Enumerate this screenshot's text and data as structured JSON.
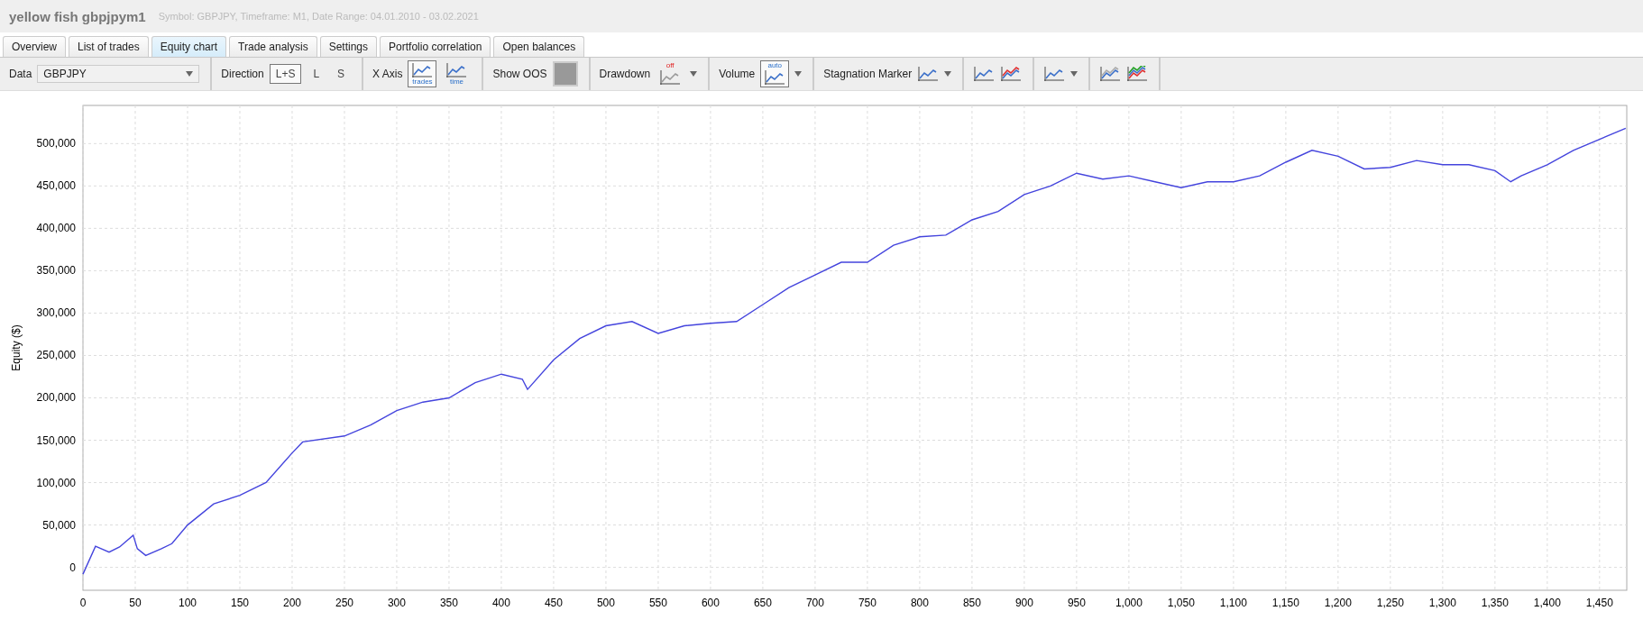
{
  "title": "yellow fish gbpjpym1",
  "subtitle": "Symbol: GBPJPY, Timeframe: M1, Date Range: 04.01.2010 - 03.02.2021",
  "tabs": [
    {
      "label": "Overview",
      "selected": false
    },
    {
      "label": "List of trades",
      "selected": false
    },
    {
      "label": "Equity chart",
      "selected": true
    },
    {
      "label": "Trade analysis",
      "selected": false
    },
    {
      "label": "Settings",
      "selected": false
    },
    {
      "label": "Portfolio correlation",
      "selected": false
    },
    {
      "label": "Open balances",
      "selected": false
    }
  ],
  "toolbar": {
    "data": {
      "label": "Data",
      "value": "GBPJPY"
    },
    "direction": {
      "label": "Direction",
      "options": [
        {
          "label": "L+S",
          "selected": true
        },
        {
          "label": "L",
          "selected": false
        },
        {
          "label": "S",
          "selected": false
        }
      ]
    },
    "x_axis": {
      "label": "X Axis",
      "options": [
        {
          "label": "trades",
          "selected": true
        },
        {
          "label": "time",
          "selected": false
        }
      ]
    },
    "show_oos": {
      "label": "Show OOS",
      "on": false
    },
    "drawdown": {
      "label": "Drawdown",
      "icon_text": "off"
    },
    "volume": {
      "label": "Volume",
      "icon_text": "auto"
    },
    "stagnation": {
      "label": "Stagnation Marker"
    }
  },
  "chart_data": {
    "type": "line",
    "ylabel": "Equity ($)",
    "x": [
      0,
      12,
      25,
      35,
      48,
      52,
      60,
      75,
      85,
      100,
      125,
      150,
      175,
      200,
      210,
      250,
      275,
      300,
      325,
      350,
      375,
      400,
      420,
      425,
      450,
      475,
      500,
      525,
      550,
      575,
      600,
      625,
      650,
      675,
      700,
      725,
      750,
      775,
      800,
      825,
      850,
      875,
      900,
      925,
      950,
      975,
      1000,
      1025,
      1050,
      1075,
      1100,
      1125,
      1150,
      1175,
      1200,
      1225,
      1250,
      1275,
      1300,
      1325,
      1350,
      1365,
      1375,
      1400,
      1425,
      1450,
      1475
    ],
    "grid": true,
    "series": [
      {
        "color": "#4444dd",
        "values": [
          -8000,
          25000,
          18000,
          24000,
          38000,
          22000,
          14000,
          22000,
          28000,
          50000,
          75000,
          85000,
          100000,
          135000,
          148000,
          155000,
          168000,
          185000,
          195000,
          200000,
          218000,
          228000,
          222000,
          210000,
          245000,
          270000,
          285000,
          290000,
          276000,
          285000,
          288000,
          290000,
          310000,
          330000,
          345000,
          360000,
          360000,
          380000,
          390000,
          392000,
          410000,
          420000,
          440000,
          450000,
          465000,
          458000,
          462000,
          455000,
          448000,
          455000,
          455000,
          462000,
          478000,
          492000,
          485000,
          470000,
          472000,
          480000,
          475000,
          475000,
          468000,
          455000,
          462000,
          475000,
          492000,
          505000,
          518000
        ]
      }
    ],
    "xlim": [
      0,
      1476
    ],
    "ylim": [
      -27000,
      545000
    ],
    "xticks": [
      {
        "value": 0,
        "label": "0"
      },
      {
        "value": 50,
        "label": "50"
      },
      {
        "value": 100,
        "label": "100"
      },
      {
        "value": 150,
        "label": "150"
      },
      {
        "value": 200,
        "label": "200"
      },
      {
        "value": 250,
        "label": "250"
      },
      {
        "value": 300,
        "label": "300"
      },
      {
        "value": 350,
        "label": "350"
      },
      {
        "value": 400,
        "label": "400"
      },
      {
        "value": 450,
        "label": "450"
      },
      {
        "value": 500,
        "label": "500"
      },
      {
        "value": 550,
        "label": "550"
      },
      {
        "value": 600,
        "label": "600"
      },
      {
        "value": 650,
        "label": "650"
      },
      {
        "value": 700,
        "label": "700"
      },
      {
        "value": 750,
        "label": "750"
      },
      {
        "value": 800,
        "label": "800"
      },
      {
        "value": 850,
        "label": "850"
      },
      {
        "value": 900,
        "label": "900"
      },
      {
        "value": 950,
        "label": "950"
      },
      {
        "value": 1000,
        "label": "1,000"
      },
      {
        "value": 1050,
        "label": "1,050"
      },
      {
        "value": 1100,
        "label": "1,100"
      },
      {
        "value": 1150,
        "label": "1,150"
      },
      {
        "value": 1200,
        "label": "1,200"
      },
      {
        "value": 1250,
        "label": "1,250"
      },
      {
        "value": 1300,
        "label": "1,300"
      },
      {
        "value": 1350,
        "label": "1,350"
      },
      {
        "value": 1400,
        "label": "1,400"
      },
      {
        "value": 1450,
        "label": "1,450"
      }
    ],
    "yticks": [
      {
        "value": 0,
        "label": "0"
      },
      {
        "value": 50000,
        "label": "50,000"
      },
      {
        "value": 100000,
        "label": "100,000"
      },
      {
        "value": 150000,
        "label": "150,000"
      },
      {
        "value": 200000,
        "label": "200,000"
      },
      {
        "value": 250000,
        "label": "250,000"
      },
      {
        "value": 300000,
        "label": "300,000"
      },
      {
        "value": 350000,
        "label": "350,000"
      },
      {
        "value": 400000,
        "label": "400,000"
      },
      {
        "value": 450000,
        "label": "450,000"
      },
      {
        "value": 500000,
        "label": "500,000"
      }
    ]
  }
}
